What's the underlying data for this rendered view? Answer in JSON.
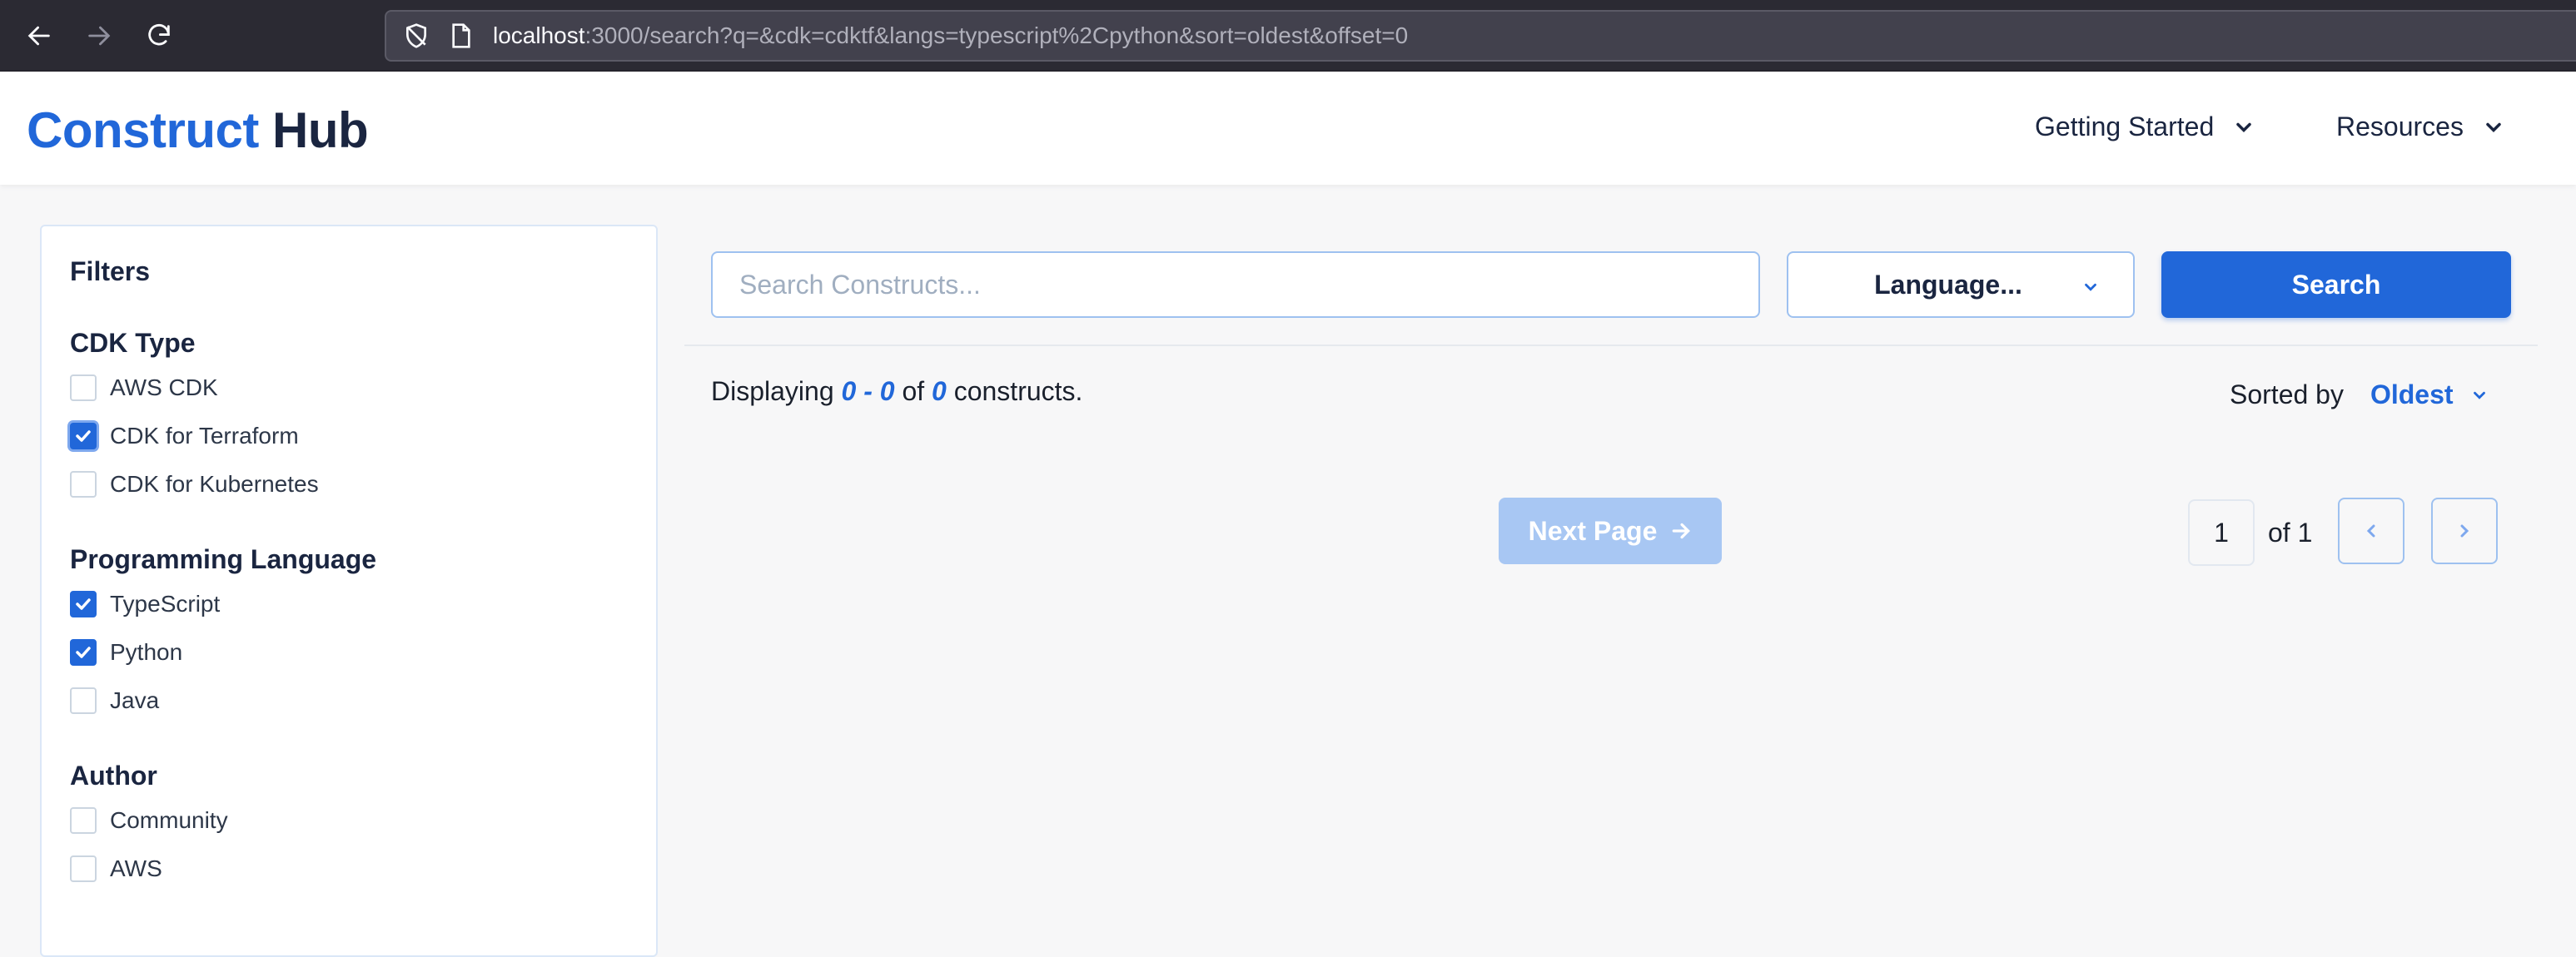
{
  "browser": {
    "url_host": "localhost",
    "url_rest": ":3000/search?q=&cdk=cdktf&langs=typescript%2Cpython&sort=oldest&offset=0"
  },
  "header": {
    "logo_part1": "Construct",
    "logo_part2": "Hub",
    "menu": [
      {
        "label": "Getting Started"
      },
      {
        "label": "Resources"
      }
    ]
  },
  "filters": {
    "title": "Filters",
    "groups": [
      {
        "title": "CDK Type",
        "items": [
          {
            "label": "AWS CDK",
            "checked": false
          },
          {
            "label": "CDK for Terraform",
            "checked": true
          },
          {
            "label": "CDK for Kubernetes",
            "checked": false
          }
        ]
      },
      {
        "title": "Programming Language",
        "items": [
          {
            "label": "TypeScript",
            "checked": true
          },
          {
            "label": "Python",
            "checked": true
          },
          {
            "label": "Java",
            "checked": false
          }
        ]
      },
      {
        "title": "Author",
        "items": [
          {
            "label": "Community",
            "checked": false
          },
          {
            "label": "AWS",
            "checked": false
          }
        ]
      }
    ]
  },
  "search": {
    "placeholder": "Search Constructs...",
    "value": "",
    "language_label": "Language...",
    "button_label": "Search"
  },
  "results": {
    "prefix": "Displaying ",
    "range": "0 - 0",
    "of": " of ",
    "total": "0",
    "suffix": " constructs.",
    "sorted_by_label": "Sorted by",
    "sort_value": "Oldest"
  },
  "pagination": {
    "next_label": "Next Page",
    "current_page": "1",
    "of_pages": "of 1"
  },
  "colors": {
    "accent": "#2167d9",
    "dark": "#1a2540",
    "disabled_button": "#a8c7f3"
  }
}
